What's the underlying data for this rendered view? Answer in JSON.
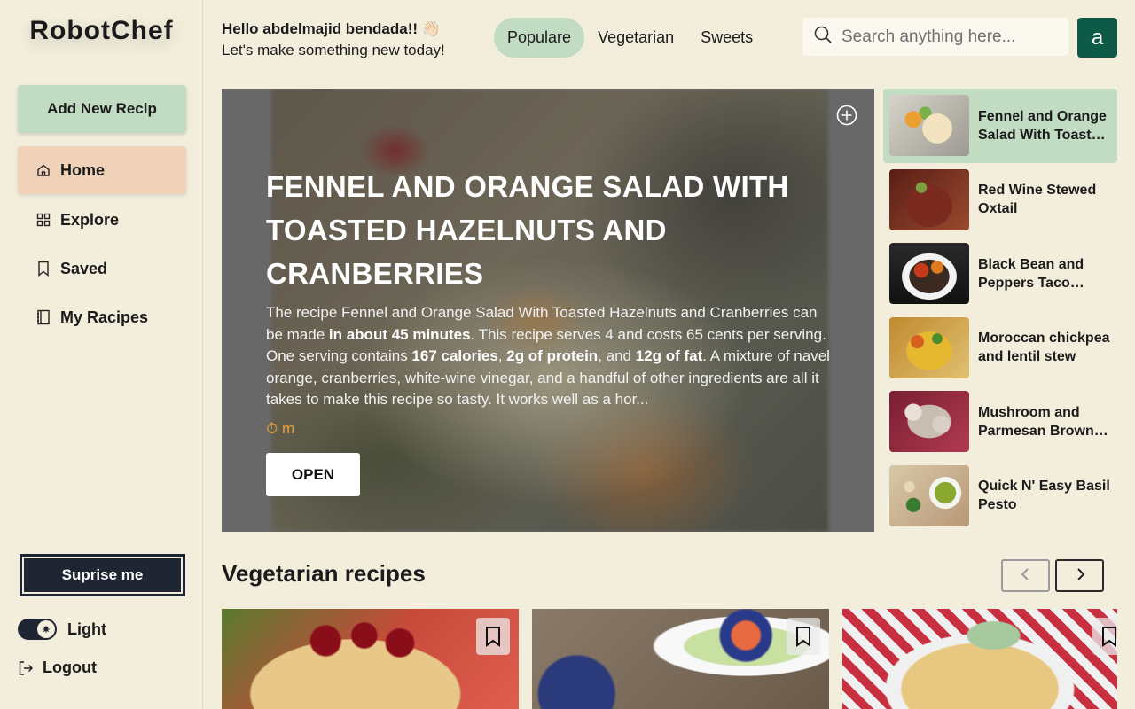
{
  "app": {
    "logo": "RobotChef"
  },
  "sidebar": {
    "add_button": "Add New Recip",
    "items": [
      {
        "label": "Home",
        "icon": "home-icon"
      },
      {
        "label": "Explore",
        "icon": "grid-icon"
      },
      {
        "label": "Saved",
        "icon": "bookmark-icon"
      },
      {
        "label": "My Racipes",
        "icon": "notebook-icon"
      }
    ],
    "surprise_button": "Suprise me",
    "theme_label": "Light",
    "logout_label": "Logout"
  },
  "header": {
    "greeting": "Hello abdelmajid bendada!! 👋🏻",
    "subtitle": "Let's make something new today!",
    "tabs": [
      "Populare",
      "Vegetarian",
      "Sweets"
    ],
    "active_tab": "Populare",
    "search_placeholder": "Search anything here...",
    "avatar_letter": "a"
  },
  "hero": {
    "title": "Fennel and Orange Salad With Toasted Hazelnuts and Cranberries",
    "desc_1": "The recipe Fennel and Orange Salad With Toasted Hazelnuts and Cranberries can be made ",
    "desc_b1": "in about 45 minutes",
    "desc_2": ". This recipe serves 4 and costs 65 cents per serving. One serving contains ",
    "desc_b2": "167 calories",
    "desc_3": ", ",
    "desc_b3": "2g of protein",
    "desc_4": ", and ",
    "desc_b4": "12g of fat",
    "desc_5": ". A mixture of navel orange, cranberries, white-wine vinegar, and a handful of other ingredients are all it takes to make this recipe so tasty. It works well as a hor...",
    "time": "⏱ m",
    "open_button": "OPEN"
  },
  "side_recipes": [
    {
      "name": "Fennel and Orange Salad With Toasted Hazelnuts and Cranberries",
      "active": true
    },
    {
      "name": "Red Wine Stewed Oxtail",
      "active": false
    },
    {
      "name": "Black Bean and Peppers Taco Filling",
      "active": false
    },
    {
      "name": "Moroccan chickpea and lentil stew",
      "active": false
    },
    {
      "name": "Mushroom and Parmesan Brown Rice",
      "active": false
    },
    {
      "name": "Quick N' Easy Basil Pesto",
      "active": false
    }
  ],
  "vegetarian": {
    "title": "Vegetarian recipes"
  },
  "colors": {
    "background": "#f3eddc",
    "accent_green": "#c1dcc3",
    "active_peach": "#f0d2b9",
    "dark": "#1f2533",
    "avatar": "#0d5a47"
  }
}
